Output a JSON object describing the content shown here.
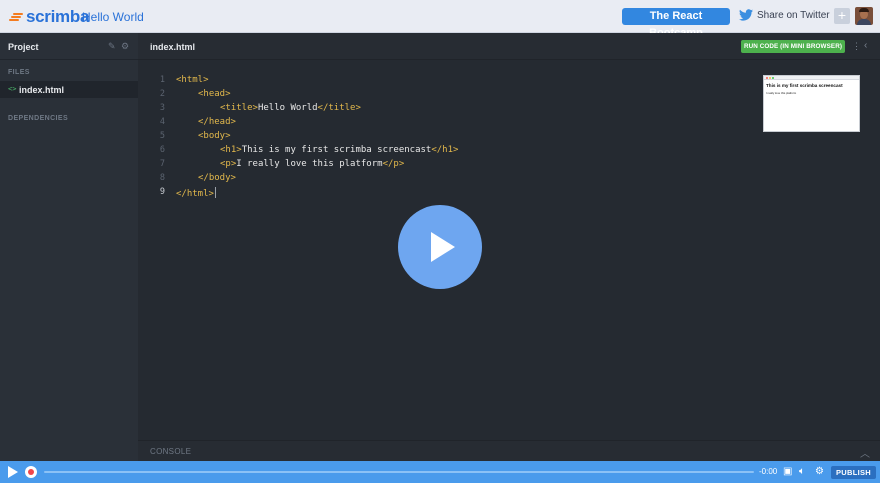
{
  "brand": {
    "logo_text": "scrimba",
    "app_title": "Hello World"
  },
  "header": {
    "bootcamp_label": "The React Bootcamp",
    "share_label": "Share on Twitter",
    "add_icon": "plus-icon",
    "avatar_icon": "user-avatar"
  },
  "sidebar": {
    "title": "Project",
    "files_label": "FILES",
    "active_file": "index.html",
    "dependencies_label": "DEPENDENCIES"
  },
  "editor": {
    "tab": "index.html",
    "run_label": "RUN CODE (IN MINI BROWSER)",
    "active_line": 9,
    "lines": [
      {
        "n": "1",
        "indent": 0,
        "parts": [
          {
            "t": "tag",
            "v": "<html>"
          }
        ]
      },
      {
        "n": "2",
        "indent": 1,
        "parts": [
          {
            "t": "tag",
            "v": "<head>"
          }
        ]
      },
      {
        "n": "3",
        "indent": 2,
        "parts": [
          {
            "t": "tag",
            "v": "<title>"
          },
          {
            "t": "txt",
            "v": "Hello World"
          },
          {
            "t": "tag",
            "v": "</title>"
          }
        ]
      },
      {
        "n": "4",
        "indent": 1,
        "parts": [
          {
            "t": "tag",
            "v": "</head>"
          }
        ]
      },
      {
        "n": "5",
        "indent": 1,
        "parts": [
          {
            "t": "tag",
            "v": "<body>"
          }
        ]
      },
      {
        "n": "6",
        "indent": 2,
        "parts": [
          {
            "t": "tag",
            "v": "<h1>"
          },
          {
            "t": "txt",
            "v": "This is my first scrimba screencast"
          },
          {
            "t": "tag",
            "v": "</h1>"
          }
        ]
      },
      {
        "n": "7",
        "indent": 2,
        "parts": [
          {
            "t": "tag",
            "v": "<p>"
          },
          {
            "t": "txt",
            "v": "I really love this platform"
          },
          {
            "t": "tag",
            "v": "</p>"
          }
        ]
      },
      {
        "n": "8",
        "indent": 1,
        "parts": [
          {
            "t": "tag",
            "v": "</body>"
          }
        ]
      },
      {
        "n": "9",
        "indent": 0,
        "parts": [
          {
            "t": "tag",
            "v": "</html>"
          }
        ]
      }
    ]
  },
  "preview": {
    "heading": "This is my first scrimba screencast",
    "paragraph": "I really love this platform"
  },
  "console": {
    "label": "CONSOLE"
  },
  "player": {
    "time": "-0:00",
    "progress": 0,
    "publish_label": "PUBLISH"
  },
  "colors": {
    "accent": "#3287e0",
    "player_bar": "#4a9bec",
    "run_green": "#4db14d",
    "code_tag": "#e2b84c",
    "editor_bg": "#252a31",
    "sidebar_bg": "#2a3038"
  }
}
